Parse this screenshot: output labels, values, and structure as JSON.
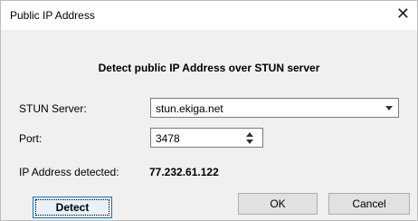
{
  "window": {
    "title": "Public IP Address",
    "close_icon": "close-icon"
  },
  "dialog": {
    "heading": "Detect public IP Address over STUN server",
    "stun_server": {
      "label": "STUN Server:",
      "value": "stun.ekiga.net"
    },
    "port": {
      "label": "Port:",
      "value": "3478"
    },
    "detected": {
      "label": "IP Address detected:",
      "value": "77.232.61.122"
    }
  },
  "buttons": {
    "detect": "Detect",
    "ok": "OK",
    "cancel": "Cancel"
  },
  "colors": {
    "focus_border": "#0078d7",
    "focus_fill": "#e5f1fb",
    "button_face": "#e1e1e1",
    "dialog_bg": "#f0f0f0"
  }
}
